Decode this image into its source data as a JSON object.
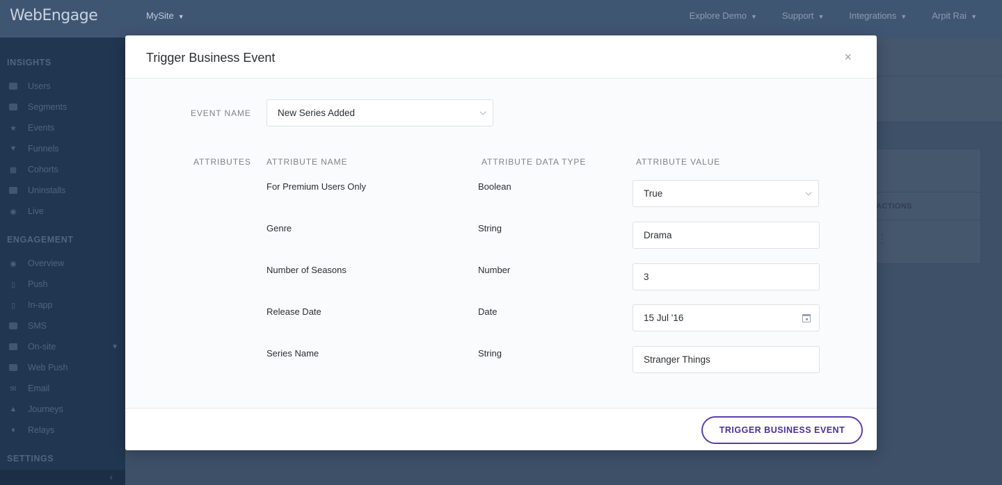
{
  "app": {
    "logo": "WebEngage",
    "site": "MySite",
    "topnav": [
      "Explore Demo",
      "Support",
      "Integrations",
      "Arpit Rai"
    ]
  },
  "sidebar": {
    "sections": [
      {
        "title": "INSIGHTS",
        "items": [
          {
            "label": "Users",
            "icon": "users-icon"
          },
          {
            "label": "Segments",
            "icon": "segments-icon"
          },
          {
            "label": "Events",
            "icon": "star-icon"
          },
          {
            "label": "Funnels",
            "icon": "funnel-icon"
          },
          {
            "label": "Cohorts",
            "icon": "grid-icon"
          },
          {
            "label": "Uninstalls",
            "icon": "uninstall-icon"
          },
          {
            "label": "Live",
            "icon": "broadcast-icon"
          }
        ]
      },
      {
        "title": "ENGAGEMENT",
        "items": [
          {
            "label": "Overview",
            "icon": "eye-icon"
          },
          {
            "label": "Push",
            "icon": "mobile-push-icon"
          },
          {
            "label": "In-app",
            "icon": "in-app-icon"
          },
          {
            "label": "SMS",
            "icon": "sms-icon"
          },
          {
            "label": "On-site",
            "icon": "on-site-icon"
          },
          {
            "label": "Web Push",
            "icon": "web-push-icon"
          },
          {
            "label": "Email",
            "icon": "email-icon"
          },
          {
            "label": "Journeys",
            "icon": "journeys-icon"
          },
          {
            "label": "Relays",
            "icon": "relays-icon"
          }
        ]
      },
      {
        "title": "SETTINGS",
        "items": []
      }
    ]
  },
  "background": {
    "table_header": "ACTIONS"
  },
  "modal": {
    "title": "Trigger Business Event",
    "close": "×",
    "event_name_label": "EVENT NAME",
    "event_name_value": "New Series Added",
    "attributes_label": "ATTRIBUTES",
    "columns": {
      "name": "ATTRIBUTE NAME",
      "type": "ATTRIBUTE DATA TYPE",
      "value": "ATTRIBUTE VALUE"
    },
    "attributes": [
      {
        "name": "For Premium Users Only",
        "type": "Boolean",
        "value": "True",
        "control": "select"
      },
      {
        "name": "Genre",
        "type": "String",
        "value": "Drama",
        "control": "input"
      },
      {
        "name": "Number of Seasons",
        "type": "Number",
        "value": "3",
        "control": "input"
      },
      {
        "name": "Release Date",
        "type": "Date",
        "value": "15 Jul '16",
        "control": "date"
      },
      {
        "name": "Series Name",
        "type": "String",
        "value": "Stranger Things",
        "control": "input"
      }
    ],
    "submit_label": "TRIGGER BUSINESS EVENT"
  },
  "colors": {
    "accent": "#5b3fa8",
    "sidebar_bg": "#213650",
    "topbar_bg": "#3f5673"
  }
}
